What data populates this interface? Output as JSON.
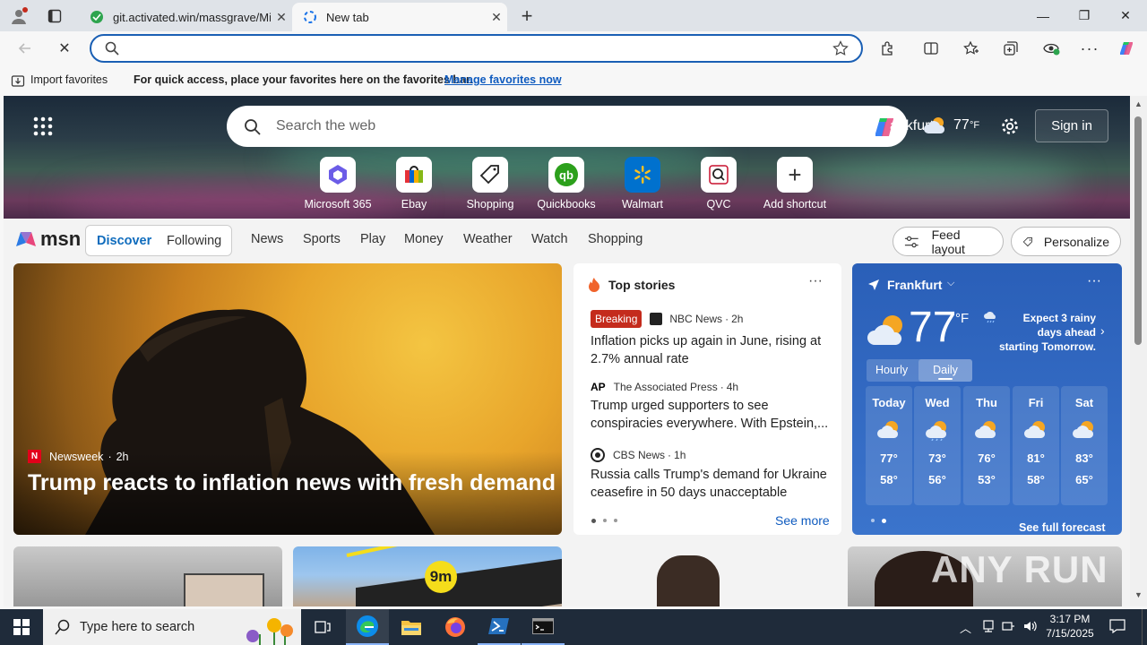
{
  "tabs": [
    {
      "title": "git.activated.win/massgrave/Micr",
      "state": "inactive"
    },
    {
      "title": "New tab",
      "state": "active"
    }
  ],
  "toolbar": {
    "address_value": ""
  },
  "favorites_bar": {
    "import_label": "Import favorites",
    "message": "For quick access, place your favorites here on the favorites bar.",
    "manage_link": "Manage favorites now"
  },
  "msn": {
    "search_placeholder": "Search the web",
    "location_partial": "ankfurt",
    "header_temp": "77",
    "header_unit": "°F",
    "sign_in": "Sign in",
    "shortcuts": [
      {
        "label": "Microsoft 365",
        "icon": "microsoft-365-icon"
      },
      {
        "label": "Ebay",
        "icon": "ebay-icon"
      },
      {
        "label": "Shopping",
        "icon": "shopping-tag-icon"
      },
      {
        "label": "Quickbooks",
        "icon": "quickbooks-icon"
      },
      {
        "label": "Walmart",
        "icon": "walmart-icon"
      },
      {
        "label": "QVC",
        "icon": "qvc-icon"
      },
      {
        "label": "Add shortcut",
        "icon": "plus-icon"
      }
    ],
    "logo": "msn",
    "feed_tabs": [
      "Discover",
      "Following"
    ],
    "nav": [
      "News",
      "Sports",
      "Play",
      "Money",
      "Weather",
      "Watch",
      "Shopping"
    ],
    "feed_layout": "Feed layout",
    "personalize": "Personalize"
  },
  "lead_story": {
    "source": "Newsweek",
    "age": "2h",
    "headline": "Trump reacts to inflation news with fresh demand"
  },
  "top_stories": {
    "title": "Top stories",
    "see_more": "See more",
    "items": [
      {
        "badge": "Breaking",
        "source": "NBC News",
        "age": "2h",
        "headline": "Inflation picks up again in June, rising at 2.7% annual rate"
      },
      {
        "badge": "",
        "source": "The Associated Press",
        "age": "4h",
        "headline": "Trump urged supporters to see conspiracies everywhere. With Epstein,..."
      },
      {
        "badge": "",
        "source": "CBS News",
        "age": "1h",
        "headline": "Russia calls Trump's demand for Ukraine ceasefire in 50 days unacceptable"
      }
    ]
  },
  "weather": {
    "city": "Frankfurt",
    "temp": "77",
    "unit": "°F",
    "alert": "Expect 3 rainy days ahead starting Tomorrow.",
    "tabs": [
      "Hourly",
      "Daily"
    ],
    "days": [
      {
        "name": "Today",
        "high": "77°",
        "low": "58°"
      },
      {
        "name": "Wed",
        "high": "73°",
        "low": "56°"
      },
      {
        "name": "Thu",
        "high": "76°",
        "low": "53°"
      },
      {
        "name": "Fri",
        "high": "81°",
        "low": "58°"
      },
      {
        "name": "Sat",
        "high": "83°",
        "low": "65°"
      }
    ],
    "see_full": "See full forecast"
  },
  "row2": {
    "badge": "9m"
  },
  "watermark": "ANY RUN",
  "taskbar": {
    "search_placeholder": "Type here to search",
    "time": "3:17 PM",
    "date": "7/15/2025"
  }
}
